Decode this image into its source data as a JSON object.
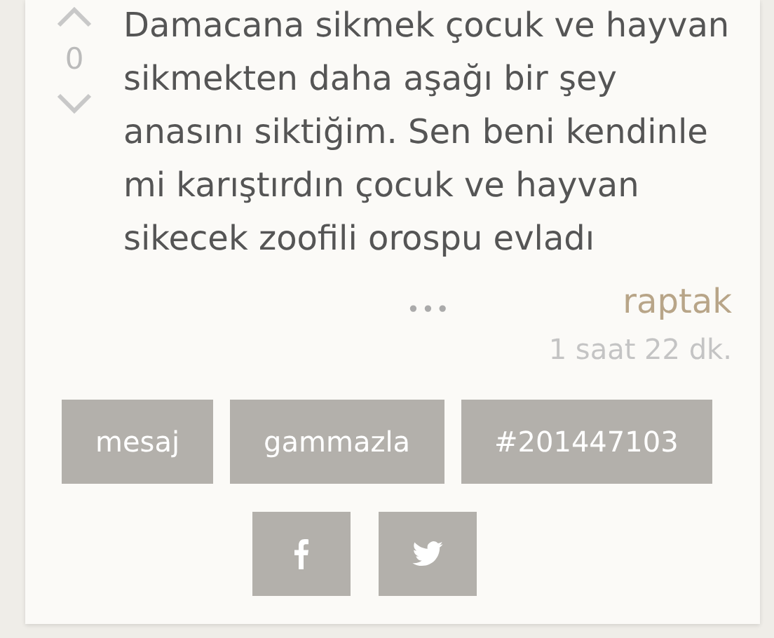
{
  "entry": {
    "votes": "0",
    "text": "Damacana sikmek çocuk ve hayvan sikmekten daha aşağı bir şey anasını siktiğim. Sen beni kendinle mi karıştırdın çocuk ve hayvan sikecek zoofili orospu evladı",
    "more": "•••",
    "author": "raptak",
    "time": "1 saat 22 dk."
  },
  "actions": [
    "mesaj",
    "gammazla",
    "#201447103"
  ],
  "share": [
    {
      "kind": "facebook"
    },
    {
      "kind": "twitter"
    }
  ]
}
